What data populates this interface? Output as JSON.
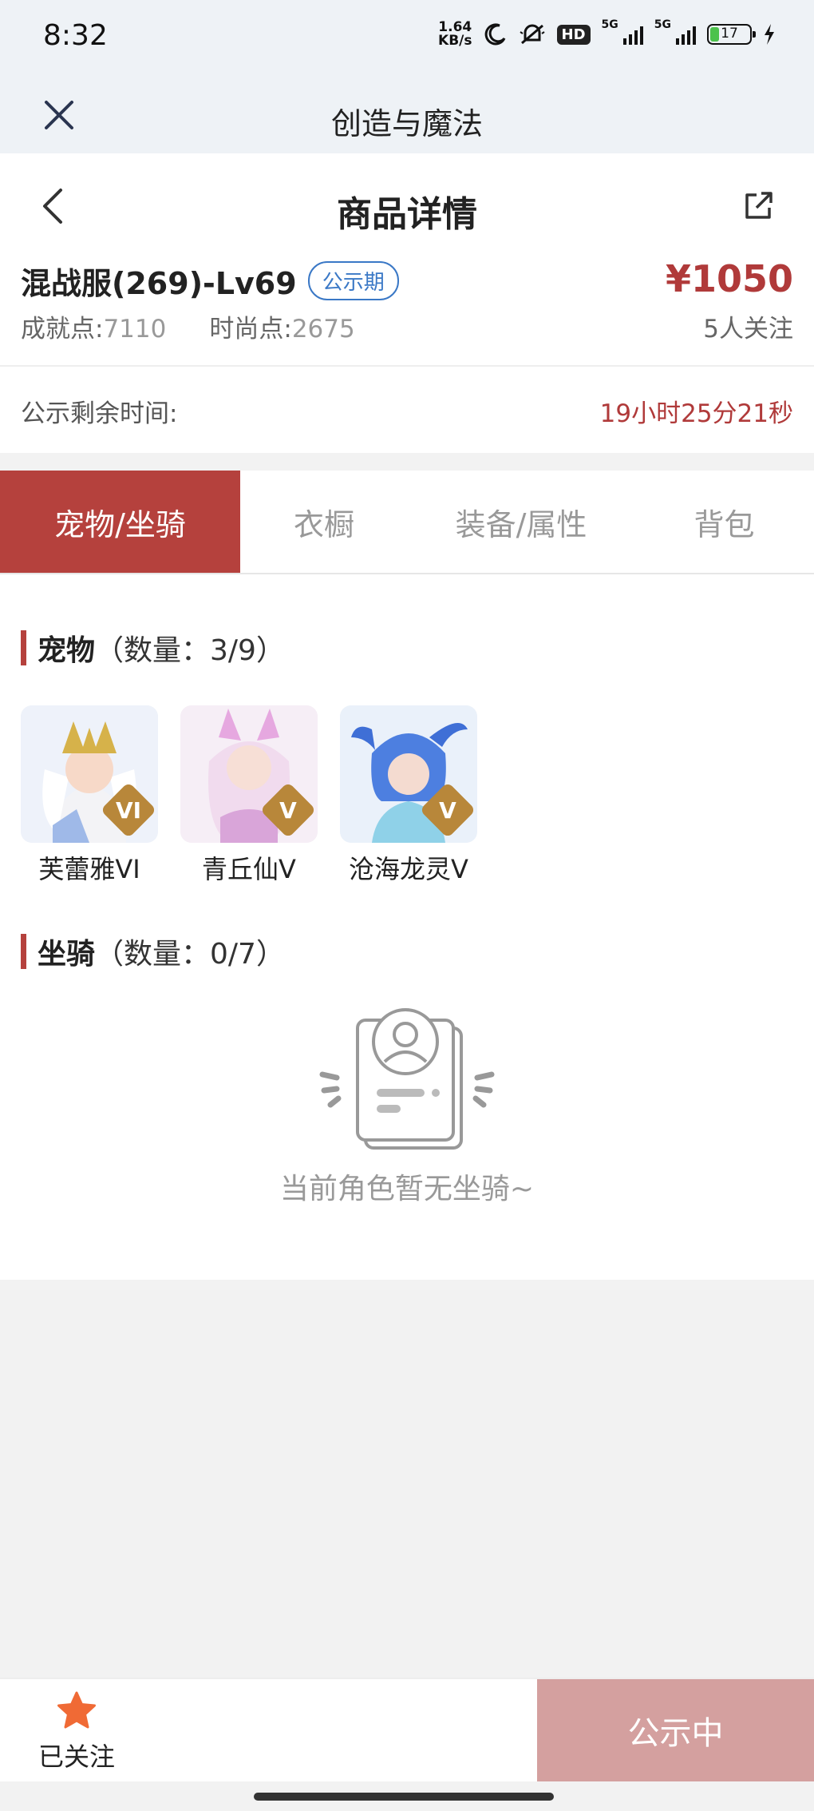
{
  "status_bar": {
    "time": "8:32",
    "speed_value": "1.64",
    "speed_unit": "KB/s",
    "hd_label": "HD",
    "net1": "5G",
    "net2": "5G",
    "battery": "17"
  },
  "app_bar": {
    "title": "创造与魔法",
    "close_icon": "close-icon"
  },
  "header": {
    "title": "商品详情",
    "back_icon": "chevron-left-icon",
    "share_icon": "share-icon"
  },
  "product": {
    "name": "混战服(269)-Lv69",
    "badge": "公示期",
    "price": "¥1050",
    "achievement_label": "成就点:",
    "achievement_value": "7110",
    "fashion_label": "时尚点:",
    "fashion_value": "2675",
    "followers": "5人关注",
    "timer_label": "公示剩余时间:",
    "timer_value": "19小时25分21秒"
  },
  "tabs": [
    {
      "label": "宠物/坐骑",
      "active": true
    },
    {
      "label": "衣橱",
      "active": false
    },
    {
      "label": "装备/属性",
      "active": false
    },
    {
      "label": "背包",
      "active": false
    }
  ],
  "pets_section": {
    "title": "宠物",
    "count": "（数量：3/9）",
    "items": [
      {
        "name": "芙蕾雅VI",
        "level": "VI",
        "colors": [
          "#e9eef8",
          "#d6b24a",
          "#9fb9e8"
        ]
      },
      {
        "name": "青丘仙V",
        "level": "V",
        "colors": [
          "#f2e6f2",
          "#d9a5d9",
          "#f7e2ee"
        ]
      },
      {
        "name": "沧海龙灵V",
        "level": "V",
        "colors": [
          "#e8f0fa",
          "#3f6fd6",
          "#8fd1e8"
        ]
      }
    ]
  },
  "mounts_section": {
    "title": "坐骑",
    "count": "（数量：0/7）",
    "empty_text": "当前角色暂无坐骑~"
  },
  "bottom_bar": {
    "follow_label": "已关注",
    "star_color": "#f06a35",
    "action_label": "公示中"
  },
  "colors": {
    "accent": "#b5413d",
    "price": "#b03a3a",
    "badge": "#3a78c6",
    "action_disabled": "#d4a09f"
  }
}
